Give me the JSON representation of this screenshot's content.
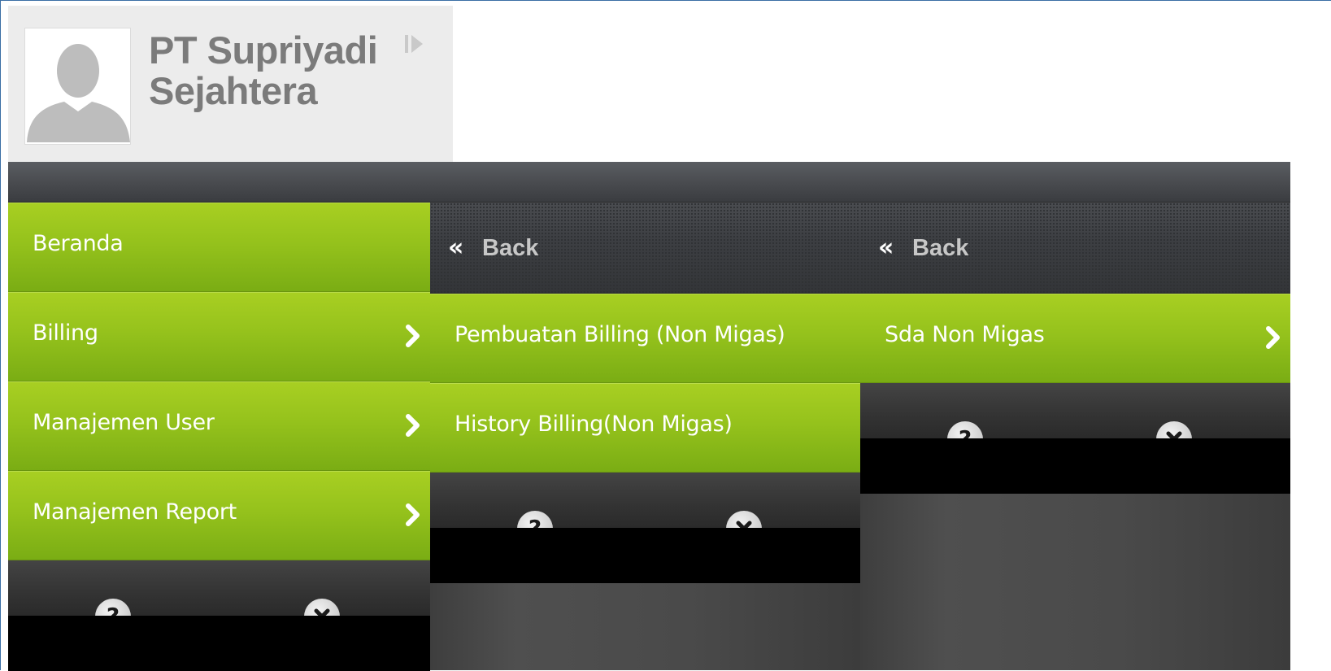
{
  "profile": {
    "company_line1": "PT Supriyadi",
    "company_line2": "Sejahtera"
  },
  "panels": [
    {
      "menu": [
        {
          "label": "Beranda",
          "has_submenu": false
        },
        {
          "label": "Billing",
          "has_submenu": true
        },
        {
          "label": "Manajemen User",
          "has_submenu": true
        },
        {
          "label": "Manajemen Report",
          "has_submenu": true
        }
      ]
    },
    {
      "back_label": "Back",
      "menu": [
        {
          "label": "Pembuatan Billing (Non Migas)",
          "has_submenu": false
        },
        {
          "label": "History Billing(Non Migas)",
          "has_submenu": false
        }
      ]
    },
    {
      "back_label": "Back",
      "menu": [
        {
          "label": "Sda Non Migas",
          "has_submenu": true
        }
      ]
    }
  ],
  "icons": {
    "back": "double-chevron-left-icon",
    "submenu": "chevron-right-icon",
    "help": "help-icon",
    "close": "close-icon",
    "collapse": "collapse-icon",
    "avatar": "avatar-icon"
  },
  "colors": {
    "menu_green": "#95c21c",
    "panel_dark": "#4a4a4a",
    "footer_black": "#000000",
    "company_text": "#7b7b7b"
  }
}
